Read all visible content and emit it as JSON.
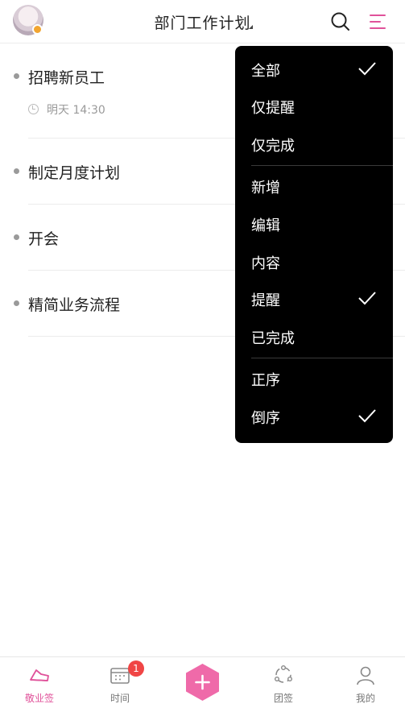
{
  "header": {
    "title": "部门工作计划",
    "avatar": "avatar-image",
    "icons": {
      "search": "search-icon",
      "menu": "menu-lines-icon"
    },
    "accent_color": "#e0529a"
  },
  "tasks": [
    {
      "title": "招聘新员工",
      "reminder": "明天 14:30"
    },
    {
      "title": "制定月度计划"
    },
    {
      "title": "开会"
    },
    {
      "title": "精简业务流程"
    }
  ],
  "dropdown": {
    "groups": [
      [
        {
          "label": "全部",
          "checked": true
        },
        {
          "label": "仅提醒",
          "checked": false
        },
        {
          "label": "仅完成",
          "checked": false
        }
      ],
      [
        {
          "label": "新增",
          "checked": false
        },
        {
          "label": "编辑",
          "checked": false
        },
        {
          "label": "内容",
          "checked": false
        },
        {
          "label": "提醒",
          "checked": true
        },
        {
          "label": "已完成",
          "checked": false
        }
      ],
      [
        {
          "label": "正序",
          "checked": false
        },
        {
          "label": "倒序",
          "checked": true
        }
      ]
    ]
  },
  "tabbar": {
    "tabs": [
      {
        "label": "敬业签",
        "icon": "slipper-note-icon",
        "active": true
      },
      {
        "label": "时间",
        "icon": "calendar-icon",
        "badge": "1",
        "active": false
      },
      {
        "label": "团签",
        "icon": "team-icon",
        "active": false
      },
      {
        "label": "我的",
        "icon": "profile-icon",
        "active": false
      }
    ],
    "add_icon": "plus-icon"
  }
}
